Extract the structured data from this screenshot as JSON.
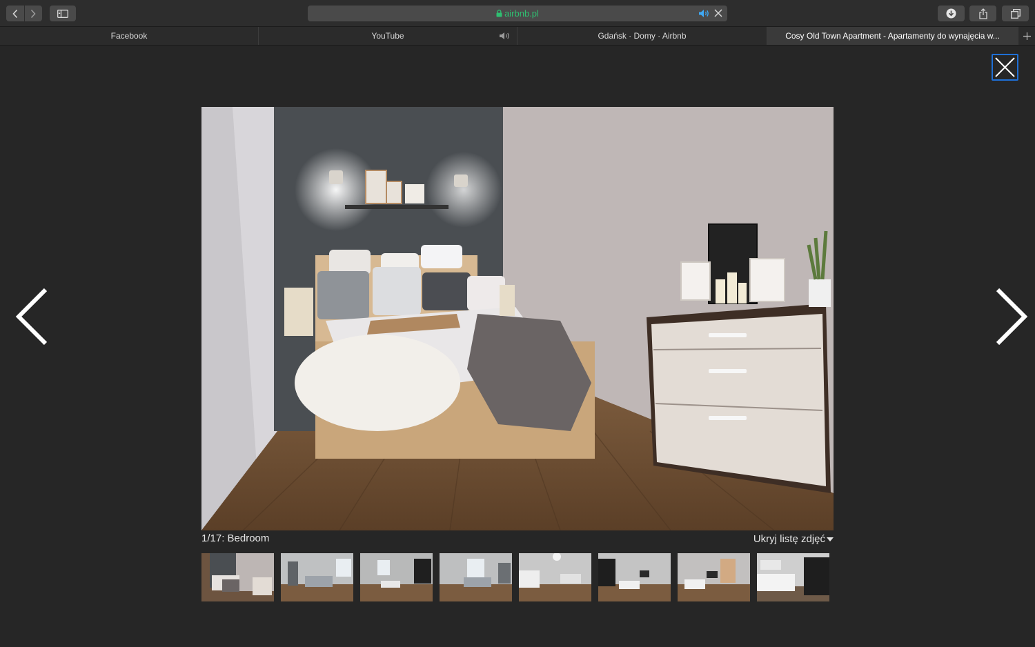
{
  "browser": {
    "url": "airbnb.pl",
    "tabs": [
      {
        "title": "Facebook",
        "active": false,
        "audio": false
      },
      {
        "title": "YouTube",
        "active": false,
        "audio": true
      },
      {
        "title": "Gdańsk · Domy · Airbnb",
        "active": false,
        "audio": false
      },
      {
        "title": "Cosy Old Town Apartment - Apartamenty do wynajęcia w...",
        "active": true,
        "audio": false
      }
    ],
    "icons": {
      "back": "chevron-left-icon",
      "forward": "chevron-right-icon",
      "sidebar": "sidebar-icon",
      "download": "download-icon",
      "share": "share-icon",
      "tabs": "tab-overview-icon",
      "new_tab": "plus-icon"
    },
    "colors": {
      "url_text": "#2fbf71",
      "audio_icon": "#3fa9f5"
    }
  },
  "lightbox": {
    "caption": "1/17: Bedroom",
    "toggle_label": "Ukryj listę zdjęć",
    "close_focus_color": "#1e6fd6",
    "thumbnails": [
      {
        "label": "bedroom",
        "selected": true
      },
      {
        "label": "living-room-1"
      },
      {
        "label": "living-room-2"
      },
      {
        "label": "living-room-3"
      },
      {
        "label": "kitchen-1"
      },
      {
        "label": "dining-chalkboard"
      },
      {
        "label": "living-room-4"
      },
      {
        "label": "kitchen-2"
      }
    ]
  }
}
